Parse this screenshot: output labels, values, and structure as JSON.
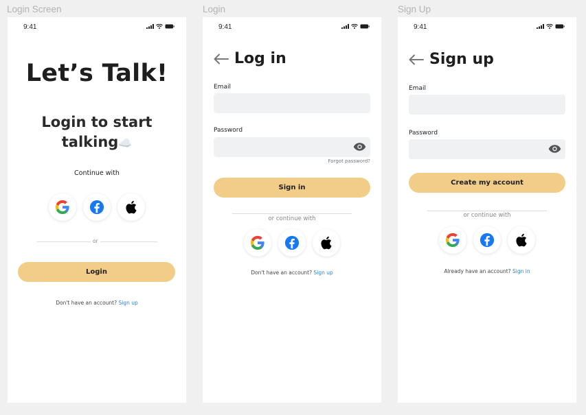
{
  "screens": {
    "login_screen": {
      "frame_label": "Login Screen",
      "time": "9:41",
      "title": "Let’s Talk!",
      "subtitle_line1": "Login to start",
      "subtitle_line2": "talking",
      "subtitle_emoji": "☁️",
      "continue_with": "Continue with",
      "or": "or",
      "login_button": "Login",
      "no_account_text": "Don't have an account?",
      "sign_up_link": "Sign up"
    },
    "login": {
      "frame_label": "Login",
      "time": "9:41",
      "title": "Log in",
      "email_label": "Email",
      "email_value": "",
      "password_label": "Password",
      "password_value": "",
      "forgot_password": "Forgot password?",
      "sign_in_button": "Sign in",
      "or_continue_with": "or continue with",
      "no_account_text": "Don't have an account?",
      "sign_up_link": "Sign up"
    },
    "signup": {
      "frame_label": "Sign Up",
      "time": "9:41",
      "title": "Sign up",
      "email_label": "Email",
      "email_value": "",
      "password_label": "Password",
      "password_value": "",
      "create_button": "Create my account",
      "or_continue_with": "or continue with",
      "have_account_text": "Already have an account?",
      "sign_in_link": "Sign in"
    }
  },
  "icons": {
    "social": [
      "google-icon",
      "facebook-icon",
      "apple-icon"
    ],
    "status": [
      "signal-icon",
      "wifi-icon",
      "battery-icon"
    ],
    "back": "arrow-left-icon",
    "password_toggle": "eye-icon"
  },
  "colors": {
    "background": "#f0f0f0",
    "frame": "#ffffff",
    "primary_button": "#f2cd88",
    "input_background": "#eff1f3",
    "link": "#2d7fd3",
    "facebook": "#1877f2",
    "frame_label": "#b3b3b3"
  }
}
